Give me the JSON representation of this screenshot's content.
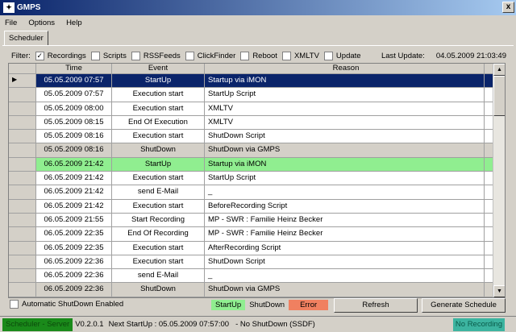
{
  "window": {
    "title": "GMPS",
    "close": "x"
  },
  "menu": [
    "File",
    "Options",
    "Help"
  ],
  "tab": "Scheduler",
  "filter": {
    "label": "Filter:",
    "options": [
      {
        "label": "Recordings",
        "checked": true
      },
      {
        "label": "Scripts",
        "checked": false
      },
      {
        "label": "RSSFeeds",
        "checked": false
      },
      {
        "label": "ClickFinder",
        "checked": false
      },
      {
        "label": "Reboot",
        "checked": false
      },
      {
        "label": "XMLTV",
        "checked": false
      },
      {
        "label": "Update",
        "checked": false
      }
    ],
    "last_update_label": "Last Update:",
    "last_update": "04.05.2009 21:03:49"
  },
  "grid": {
    "columns": [
      "Time",
      "Event",
      "Reason"
    ],
    "rows": [
      {
        "time": "05.05.2009 07:57",
        "event": "StartUp",
        "reason": "Startup via iMON",
        "style": "sel"
      },
      {
        "time": "05.05.2009 07:57",
        "event": "Execution start",
        "reason": "StartUp Script",
        "style": ""
      },
      {
        "time": "05.05.2009 08:00",
        "event": "Execution start",
        "reason": "XMLTV",
        "style": ""
      },
      {
        "time": "05.05.2009 08:15",
        "event": "End Of Execution",
        "reason": "XMLTV",
        "style": ""
      },
      {
        "time": "05.05.2009 08:16",
        "event": "Execution start",
        "reason": "ShutDown Script",
        "style": ""
      },
      {
        "time": "05.05.2009 08:16",
        "event": "ShutDown",
        "reason": "ShutDown via GMPS",
        "style": "grey"
      },
      {
        "time": "06.05.2009 21:42",
        "event": "StartUp",
        "reason": "Startup via iMON",
        "style": "green"
      },
      {
        "time": "06.05.2009 21:42",
        "event": "Execution start",
        "reason": "StartUp Script",
        "style": ""
      },
      {
        "time": "06.05.2009 21:42",
        "event": "send E-Mail",
        "reason": "_",
        "style": ""
      },
      {
        "time": "06.05.2009 21:42",
        "event": "Execution start",
        "reason": "BeforeRecording Script",
        "style": ""
      },
      {
        "time": "06.05.2009 21:55",
        "event": "Start Recording",
        "reason": "MP - SWR : Familie Heinz Becker",
        "style": ""
      },
      {
        "time": "06.05.2009 22:35",
        "event": "End Of Recording",
        "reason": "MP - SWR : Familie Heinz Becker",
        "style": ""
      },
      {
        "time": "06.05.2009 22:35",
        "event": "Execution start",
        "reason": "AfterRecording Script",
        "style": ""
      },
      {
        "time": "06.05.2009 22:36",
        "event": "Execution start",
        "reason": "ShutDown Script",
        "style": ""
      },
      {
        "time": "06.05.2009 22:36",
        "event": "send E-Mail",
        "reason": "_",
        "style": ""
      },
      {
        "time": "06.05.2009 22:36",
        "event": "ShutDown",
        "reason": "ShutDown via GMPS",
        "style": "grey"
      }
    ]
  },
  "bottom": {
    "auto_shutdown": "Automatic ShutDown Enabled",
    "legend": [
      "StartUp",
      "ShutDown",
      "Error"
    ],
    "refresh": "Refresh",
    "generate": "Generate Schedule"
  },
  "status": {
    "mode": "Scheduler - Server",
    "version": "V0.2.0.1",
    "next": "Next StartUp : 05.05.2009 07:57:00",
    "shutdown": "- No ShutDown (SSDF)",
    "recording": "No Recording"
  },
  "colors": {
    "startup": "#90ee90",
    "error": "#f08060",
    "mode": "#1a8a1a",
    "recording": "#3cb4a0"
  }
}
